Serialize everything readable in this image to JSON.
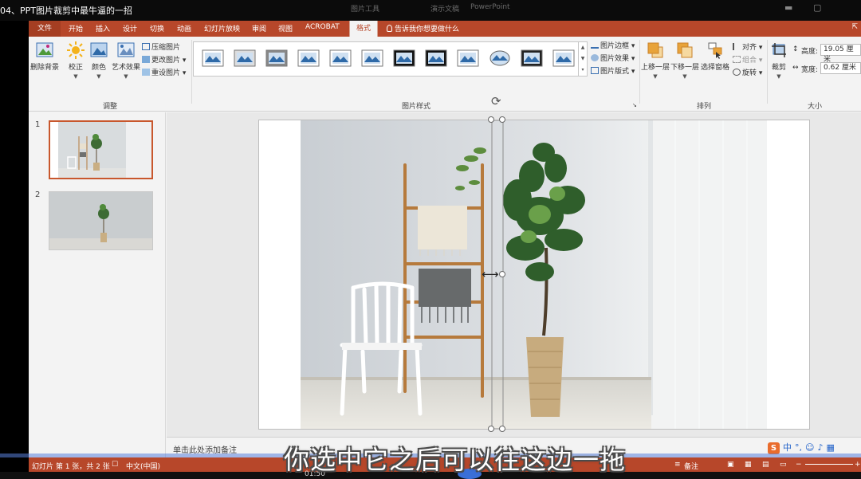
{
  "video": {
    "title": "04、PPT图片裁剪中最牛逼的一招",
    "time": "01:50"
  },
  "ghost_titles": [
    "图片工具",
    "演示文稿",
    "PowerPoint"
  ],
  "tabs": [
    {
      "id": "file",
      "label": "文件"
    },
    {
      "id": "home",
      "label": "开始"
    },
    {
      "id": "insert",
      "label": "插入"
    },
    {
      "id": "design",
      "label": "设计"
    },
    {
      "id": "transitions",
      "label": "切换"
    },
    {
      "id": "animations",
      "label": "动画"
    },
    {
      "id": "slideshow",
      "label": "幻灯片放映"
    },
    {
      "id": "review",
      "label": "审阅"
    },
    {
      "id": "view",
      "label": "视图"
    },
    {
      "id": "acrobat",
      "label": "ACROBAT"
    },
    {
      "id": "format",
      "label": "格式",
      "active": true
    }
  ],
  "tell_me": "告诉我你想要做什么",
  "ribbon": {
    "adjust": {
      "remove_bg": "删除背景",
      "corrections": "校正",
      "color": "颜色",
      "artistic": "艺术效果",
      "compress": "压缩图片",
      "change": "更改图片",
      "reset": "重设图片",
      "label": "调整"
    },
    "styles": {
      "label": "图片样式",
      "border": "图片边框",
      "effects": "图片效果",
      "layout": "图片版式",
      "count": 12
    },
    "arrange": {
      "forward": "上移一层",
      "backward": "下移一层",
      "pane": "选择窗格",
      "align": "对齐",
      "group": "组合",
      "rotate": "旋转",
      "label": "排列"
    },
    "size": {
      "crop": "裁剪",
      "height_label": "高度:",
      "height": "19.05 厘米",
      "width_label": "宽度:",
      "width": "0.62 厘米",
      "label": "大小"
    }
  },
  "slides": [
    {
      "num": "1"
    },
    {
      "num": "2"
    }
  ],
  "notes_placeholder": "单击此处添加备注",
  "ime": {
    "logo": "S",
    "lang": "中"
  },
  "status": {
    "slide_info": "幻灯片 第 1 张，共 2 张",
    "language": "中文(中国)",
    "notes": "备注"
  },
  "subtitle": "你选中它之后可以往这边一拖",
  "colors": {
    "accent": "#b7472a",
    "accent_dark": "#a53e22",
    "selection": "#c8572d"
  }
}
